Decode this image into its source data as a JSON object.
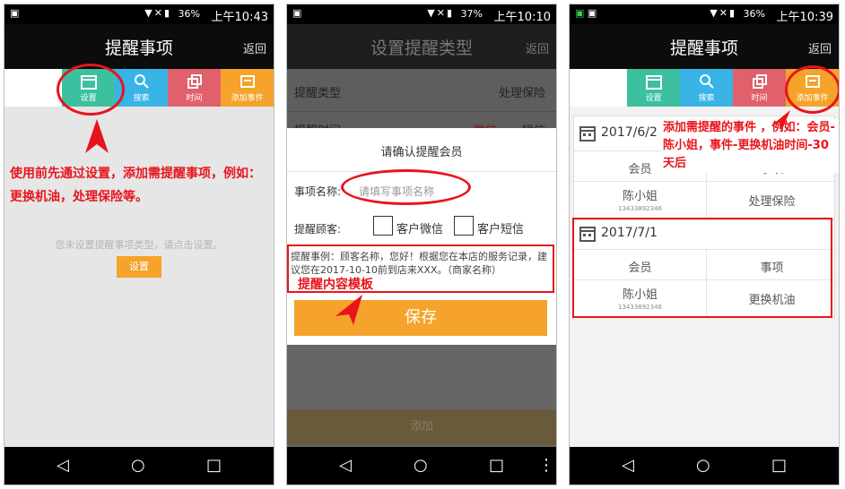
{
  "phone1": {
    "status": {
      "battery": "36%",
      "time": "上午10:43"
    },
    "title": "提醒事项",
    "back": "返回",
    "tabs": [
      "设置",
      "搜索",
      "时间",
      "添加事件"
    ],
    "annotation": "使用前先通过设置，添加需提醒事项，例如：更换机油，处理保险等。",
    "empty_hint": "您未设置提醒事项类型，请点击设置。",
    "setup_button": "设置"
  },
  "phone2": {
    "status": {
      "battery": "37%",
      "time": "上午10:10"
    },
    "title": "设置提醒类型",
    "back": "返回",
    "bg_row1_label": "提醒类型",
    "bg_row1_value": "处理保险",
    "bg_row2_label": "提醒时间",
    "bg_row2_opt1": "微信",
    "bg_row2_opt2": "短信",
    "dialog": {
      "title": "请确认提醒会员",
      "name_label": "事项名称:",
      "name_placeholder": "请填写事项名称",
      "customer_label": "提醒顾客:",
      "wechat": "客户微信",
      "sms": "客户短信",
      "example": "提醒事例：顾客名称，您好！根据您在本店的服务记录，建议您在2017-10-10前到店来XXX。（商家名称）",
      "save": "保存"
    },
    "annotation": "提醒内容模板",
    "add_button": "添加"
  },
  "phone3": {
    "status": {
      "battery": "36%",
      "time": "上午10:39"
    },
    "title": "提醒事项",
    "back": "返回",
    "tabs": [
      "设置",
      "搜索",
      "时间",
      "添加事件"
    ],
    "annotation": "添加需提醒的事件 ，例如：会员-陈小姐，事件-更换机油时间-30天后",
    "records": [
      {
        "date": "2017/6/2",
        "member_header": "会员",
        "item_header": "事项",
        "member": "陈小姐",
        "phone": "13433892346",
        "item": "处理保险"
      },
      {
        "date": "2017/7/1",
        "member_header": "会员",
        "item_header": "事项",
        "member": "陈小姐",
        "phone": "13433892346",
        "item": "更换机油"
      }
    ]
  },
  "colors": {
    "tab_setup": "#3cc0a0",
    "tab_search": "#38b4e6",
    "tab_time": "#e0606c",
    "tab_add": "#f5a32a",
    "accent": "#f5a32a",
    "annotation": "#e8141c"
  }
}
